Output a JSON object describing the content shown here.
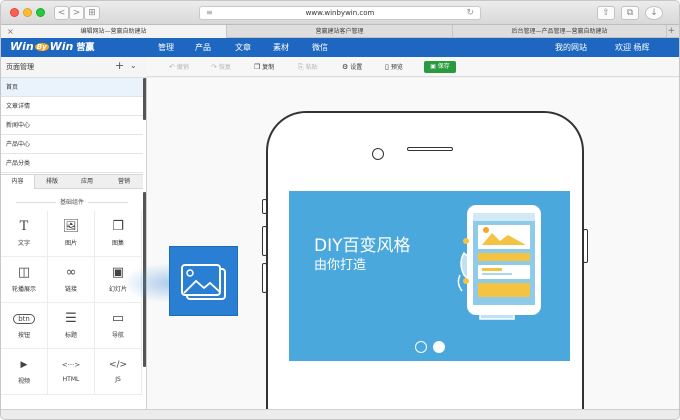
{
  "browser": {
    "url": "www.winbywin.com",
    "tabs": [
      "编辑网站—营赢自助建站",
      "营赢建站客户管理",
      "后台管理—产品管理—营赢自助建站"
    ],
    "nav_back": "<",
    "nav_forward": ">",
    "nav_sidebar": "⊞",
    "share_icon": "⇧",
    "tabs_icon": "⧉",
    "download_icon": "↓",
    "reload_icon": "↻",
    "doc_icon": "≡",
    "tab_close": "×",
    "tab_plus": "+"
  },
  "header": {
    "logo_win1": "Win",
    "logo_by": "By",
    "logo_win2": "Win",
    "logo_cn": "营赢",
    "nav": [
      "管理",
      "产品",
      "文章",
      "素材",
      "微信"
    ],
    "my_site": "我的网站",
    "welcome": "欢迎 杨辉"
  },
  "toolbar": {
    "undo": "撤销",
    "redo": "恢复",
    "copy": "复制",
    "paste": "粘贴",
    "settings": "设置",
    "preview": "预览",
    "save": "保存"
  },
  "sidebar": {
    "title": "页面管理",
    "plus": "+",
    "chevron": "⌄",
    "pages": [
      "首页",
      "文章详情",
      "新闻中心",
      "产品中心",
      "产品分类"
    ],
    "panel_tabs": [
      "内容",
      "排版",
      "应用",
      "营销"
    ],
    "section_label": "基础组件",
    "components": [
      {
        "label": "文字",
        "glyph": "T",
        "icon": "text-icon"
      },
      {
        "label": "图片",
        "glyph": "🖼",
        "icon": "image-icon"
      },
      {
        "label": "图集",
        "glyph": "❐",
        "icon": "gallery-icon"
      },
      {
        "label": "轮播展示",
        "glyph": "◫",
        "icon": "carousel-icon"
      },
      {
        "label": "链接",
        "glyph": "∞",
        "icon": "link-icon"
      },
      {
        "label": "幻灯片",
        "glyph": "▣",
        "icon": "slideshow-icon"
      },
      {
        "label": "按钮",
        "glyph": "btn",
        "icon": "button-icon"
      },
      {
        "label": "标题",
        "glyph": "☰",
        "icon": "heading-icon"
      },
      {
        "label": "导航",
        "glyph": "▭",
        "icon": "navigation-icon"
      },
      {
        "label": "视频",
        "glyph": "▶",
        "icon": "video-icon"
      },
      {
        "label": "HTML",
        "glyph": "<···>",
        "icon": "html-icon"
      },
      {
        "label": "JS",
        "glyph": "</>",
        "icon": "js-icon"
      }
    ]
  },
  "canvas": {
    "banner_line1": "DIY百变风格",
    "banner_line2": "由你打造"
  },
  "colors": {
    "brand": "#1e67c0",
    "save_green": "#2a9a3f",
    "banner_blue": "#4aa8dc",
    "feature_blue": "#2b7fd3"
  }
}
